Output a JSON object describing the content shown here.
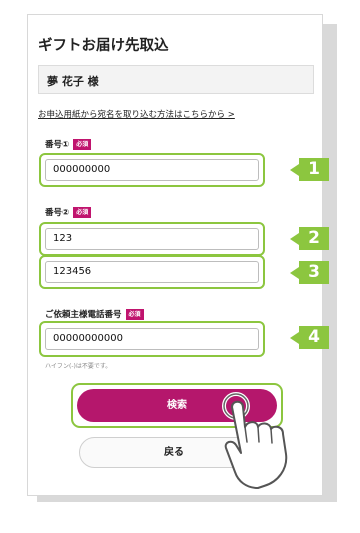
{
  "page": {
    "title": "ギフトお届け先取込",
    "recipient_name": "夢 花子 様",
    "help_link": "お申込用紙から宛名を取り込む方法はこちらから >"
  },
  "form": {
    "required_badge": "必須",
    "field1": {
      "label": "番号①",
      "value": "000000000",
      "step": "1"
    },
    "field2": {
      "label": "番号②",
      "value_a": "123",
      "step_a": "2",
      "value_b": "123456",
      "step_b": "3"
    },
    "phone": {
      "label": "ご依頼主様電話番号",
      "value": "00000000000",
      "hint": "ハイフン(-)は不要です。",
      "step": "4"
    }
  },
  "buttons": {
    "search_label": "検索",
    "back_label": "戻る"
  },
  "colors": {
    "accent_magenta": "#b5176c",
    "highlight_green": "#8cc63f"
  }
}
